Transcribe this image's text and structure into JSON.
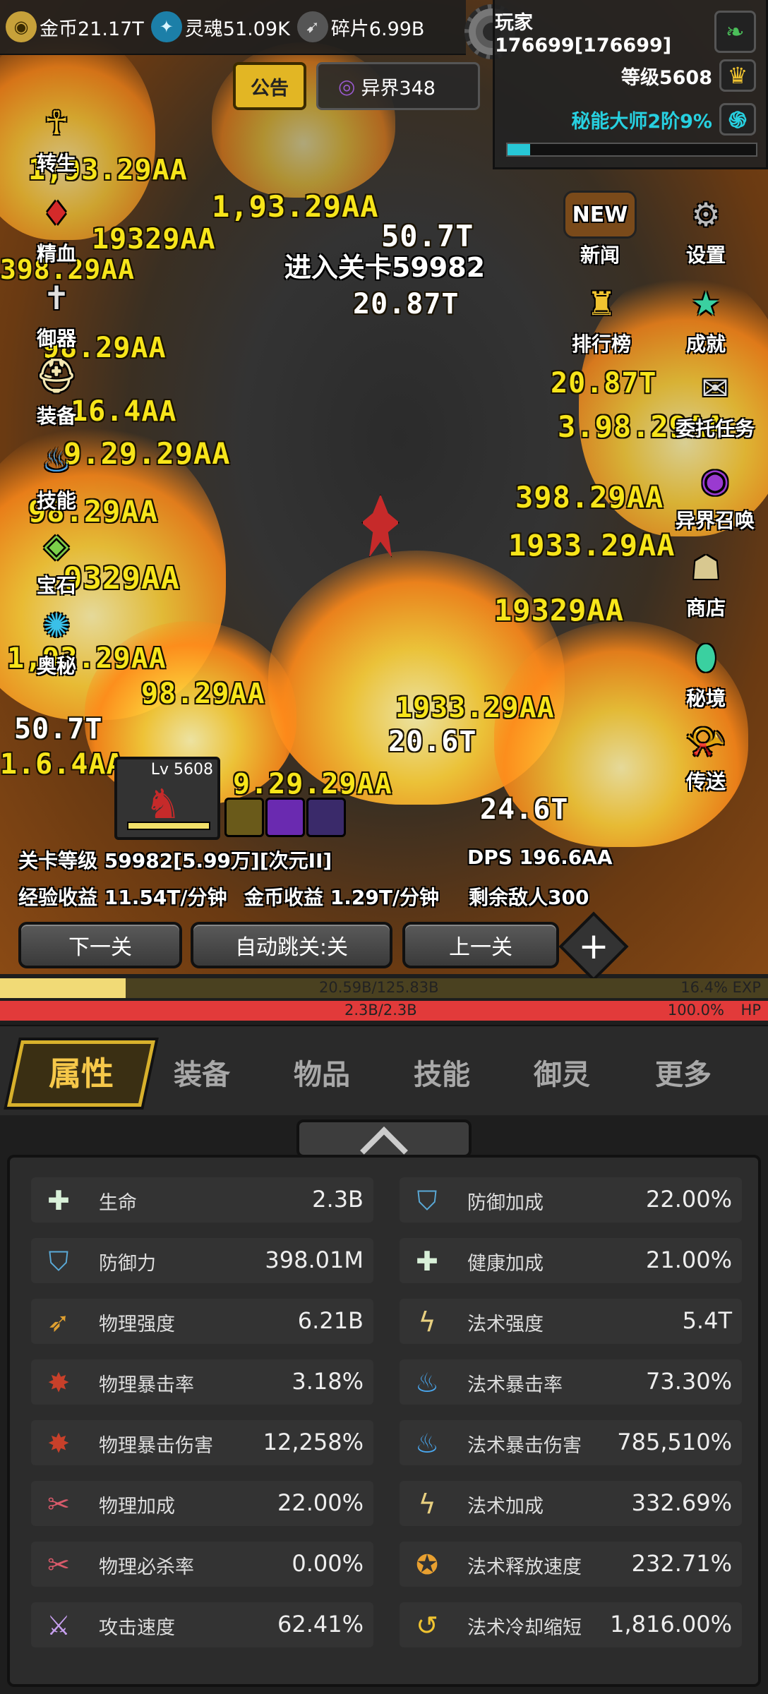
{
  "resources": [
    {
      "icon": "gold-coin-icon",
      "text": "金币21.17T"
    },
    {
      "icon": "soul-icon",
      "text": "灵魂51.09K"
    },
    {
      "icon": "shard-icon",
      "text": "碎片6.99B"
    }
  ],
  "player": {
    "name": "玩家176699[176699]",
    "level": "等级5608",
    "mastery": "秘能大师2阶9%",
    "mastery_progress": 0.09
  },
  "notice_label": "公告",
  "otherworld_label": "异界348",
  "left_menu": [
    "转生",
    "精血",
    "御器",
    "装备",
    "技能",
    "宝石",
    "奥秘"
  ],
  "right_menu": [
    "新闻",
    "设置",
    "排行榜",
    "成就",
    "委托任务",
    "异界召唤",
    "商店",
    "秘境",
    "传送"
  ],
  "news_badge": "NEW",
  "stage_banner": "进入关卡59982",
  "damage_numbers": [
    "1,93.29AA",
    "1,93.29AA",
    "50.7T",
    "20.87T",
    "20.87T",
    "398.29AA",
    "3.98.29AA",
    "16.4AA",
    "9.29.29AA",
    "98.29AA",
    "9329AA",
    "50.7T",
    "20.6T",
    "24.6T",
    "1933.29AA",
    "398.29AA",
    "19329AA",
    "1.6.4AA"
  ],
  "hero_card": {
    "level": "Lv 5608"
  },
  "info": {
    "stage_level": "关卡等级 59982[5.99万][次元II]",
    "dps": "DPS 196.6AA",
    "exp_rate": "经验收益 11.54T/分钟",
    "gold_rate": "金币收益 1.29T/分钟",
    "enemies_left": "剩余敌人300"
  },
  "buttons": {
    "next": "下一关",
    "auto": "自动跳关:关",
    "prev": "上一关",
    "plus": "+"
  },
  "exp_bar": {
    "value": "20.59B/125.83B",
    "percent": "16.4% EXP",
    "fraction": 0.164
  },
  "hp_bar": {
    "value": "2.3B/2.3B",
    "percent": "100.0%",
    "label": "HP",
    "fraction": 1.0
  },
  "tabs": [
    "属性",
    "装备",
    "物品",
    "技能",
    "御灵",
    "更多"
  ],
  "stats_left": [
    {
      "icon": "life-cross-icon",
      "name": "生命",
      "value": "2.3B"
    },
    {
      "icon": "shield-icon",
      "name": "防御力",
      "value": "398.01M"
    },
    {
      "icon": "sword-arrow-icon",
      "name": "物理强度",
      "value": "6.21B"
    },
    {
      "icon": "physical-crit-icon",
      "name": "物理暴击率",
      "value": "3.18%"
    },
    {
      "icon": "physical-crit-icon",
      "name": "物理暴击伤害",
      "value": "12,258%"
    },
    {
      "icon": "physical-bonus-icon",
      "name": "物理加成",
      "value": "22.00%"
    },
    {
      "icon": "physical-bonus-icon",
      "name": "物理必杀率",
      "value": "0.00%"
    },
    {
      "icon": "attack-speed-icon",
      "name": "攻击速度",
      "value": "62.41%"
    }
  ],
  "stats_right": [
    {
      "icon": "shield-icon",
      "name": "防御加成",
      "value": "22.00%"
    },
    {
      "icon": "life-cross-icon",
      "name": "健康加成",
      "value": "21.00%"
    },
    {
      "icon": "lightning-icon",
      "name": "法术强度",
      "value": "5.4T"
    },
    {
      "icon": "blue-flame-icon",
      "name": "法术暴击率",
      "value": "73.30%"
    },
    {
      "icon": "blue-flame-icon",
      "name": "法术暴击伤害",
      "value": "785,510%"
    },
    {
      "icon": "lightning-icon",
      "name": "法术加成",
      "value": "332.69%"
    },
    {
      "icon": "cast-speed-icon",
      "name": "法术释放速度",
      "value": "232.71%"
    },
    {
      "icon": "cooldown-icon",
      "name": "法术冷却缩短",
      "value": "1,816.00%"
    }
  ]
}
